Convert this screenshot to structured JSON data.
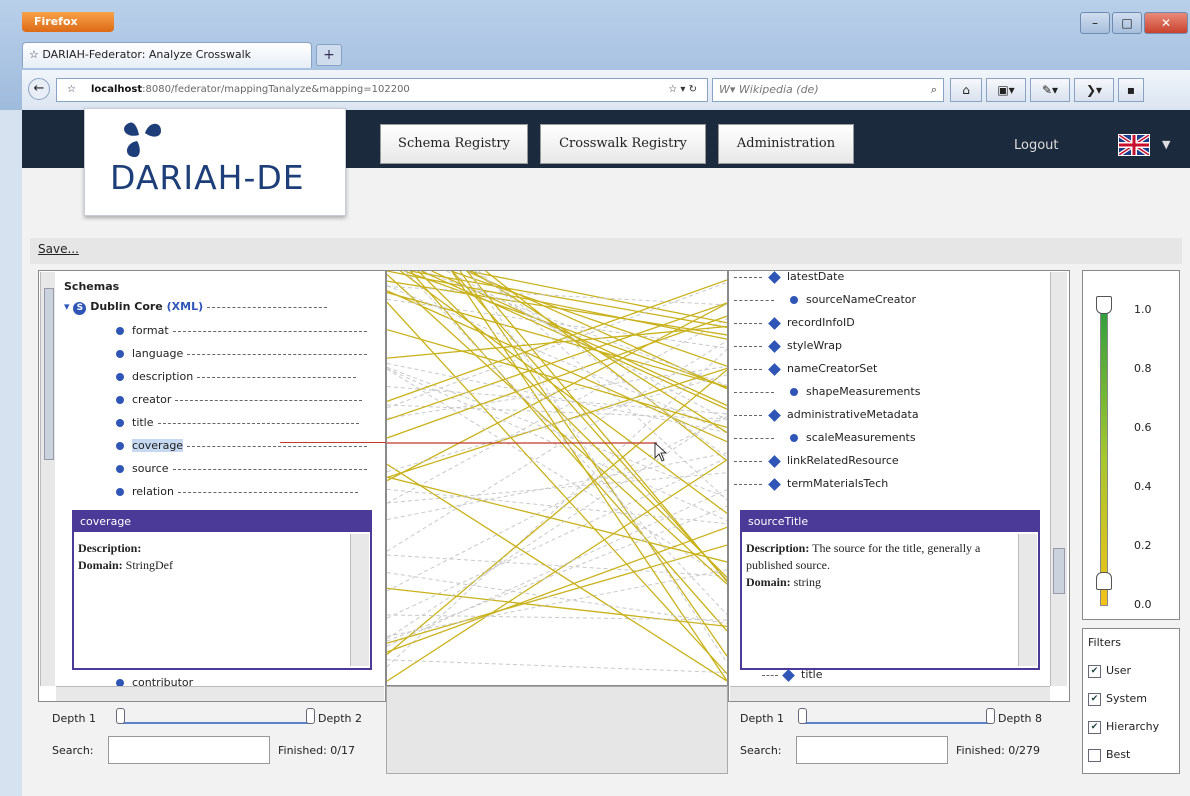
{
  "browser": {
    "app_button": "Firefox",
    "tab_title": "DARIAH-Federator: Analyze Crosswalk",
    "new_tab": "+",
    "url_host": "localhost",
    "url_rest": ":8080/federator/mappingTanalyze&mapping=102200",
    "search_placeholder": "W▾ Wikipedia (de)"
  },
  "app": {
    "logo": "DARIAH-DE",
    "nav": [
      "Schema Registry",
      "Crosswalk Registry",
      "Administration"
    ],
    "logout": "Logout",
    "save": "Save..."
  },
  "left_tree": {
    "root": "Schemas",
    "schema": "Dublin Core",
    "schema_type": "(XML)",
    "items": [
      "format",
      "language",
      "description",
      "creator",
      "title",
      "coverage",
      "source",
      "relation"
    ],
    "bottom_item": "contributor",
    "depth_min": "Depth 1",
    "depth_max": "Depth 2",
    "search_label": "Search:",
    "finished": "Finished: 0/17"
  },
  "left_popup": {
    "title": "coverage",
    "desc_label": "Description:",
    "desc": "",
    "domain_label": "Domain:",
    "domain": "StringDef"
  },
  "right_tree": {
    "items": [
      {
        "label": "latestDate",
        "kind": "diamond"
      },
      {
        "label": "sourceNameCreator",
        "kind": "dot"
      },
      {
        "label": "recordInfoID",
        "kind": "diamond"
      },
      {
        "label": "styleWrap",
        "kind": "diamond"
      },
      {
        "label": "nameCreatorSet",
        "kind": "diamond"
      },
      {
        "label": "shapeMeasurements",
        "kind": "dot"
      },
      {
        "label": "administrativeMetadata",
        "kind": "diamond"
      },
      {
        "label": "scaleMeasurements",
        "kind": "dot"
      },
      {
        "label": "linkRelatedResource",
        "kind": "diamond"
      },
      {
        "label": "termMaterialsTech",
        "kind": "diamond"
      }
    ],
    "bottom_item": "title",
    "depth_min": "Depth 1",
    "depth_max": "Depth 8",
    "search_label": "Search:",
    "finished": "Finished: 0/279"
  },
  "right_popup": {
    "title": "sourceTitle",
    "desc_label": "Description:",
    "desc": "The source for the title, generally a published source.",
    "domain_label": "Domain:",
    "domain": "string"
  },
  "slider": {
    "ticks": [
      "1.0",
      "0.8",
      "0.6",
      "0.4",
      "0.2",
      "0.0"
    ],
    "upper": 1.0,
    "lower": 0.0
  },
  "filters": {
    "title": "Filters",
    "items": [
      {
        "label": "User",
        "checked": true
      },
      {
        "label": "System",
        "checked": true
      },
      {
        "label": "Hierarchy",
        "checked": true
      },
      {
        "label": "Best",
        "checked": false
      }
    ]
  },
  "colors": {
    "appbar": "#1c2a3e",
    "mapping_line": "#c9b21c",
    "selected_mapping": "#c0392b",
    "popup_header": "#4b3a97"
  }
}
